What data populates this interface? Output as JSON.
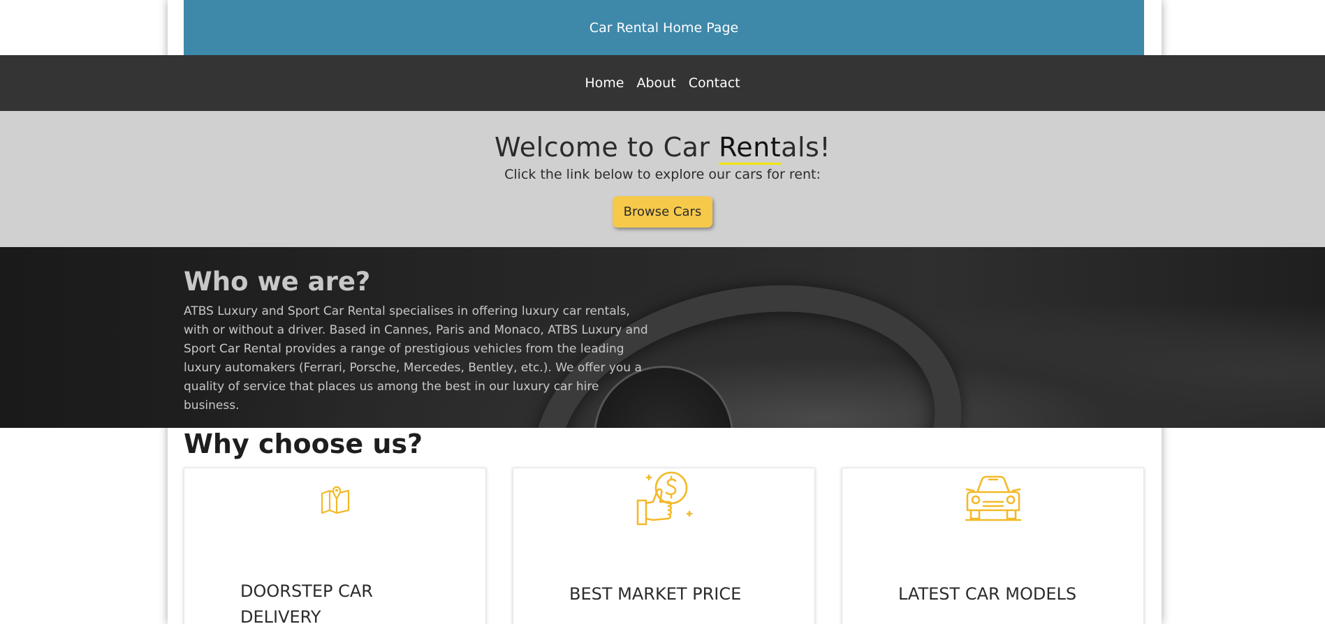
{
  "header": {
    "title": "Car Rental Home Page"
  },
  "nav": {
    "items": [
      {
        "label": "Home"
      },
      {
        "label": "About"
      },
      {
        "label": "Contact"
      }
    ]
  },
  "welcome": {
    "heading_pre": "Welcome to Car ",
    "heading_highlight": "Rent",
    "heading_post": "als!",
    "subtitle": "Click the link below to explore our cars for rent:",
    "button_label": "Browse Cars"
  },
  "about": {
    "heading": "Who we are?",
    "body": "ATBS Luxury and Sport Car Rental specialises in offering luxury car rentals, with or without a driver. Based in Cannes, Paris and Monaco, ATBS Luxury and Sport Car Rental provides a range of prestigious vehicles from the leading luxury automakers (Ferrari, Porsche, Mercedes, Bentley, etc.). We offer you a quality of service that places us among the best in our luxury car hire business."
  },
  "why": {
    "heading": "Why choose us?",
    "cards": [
      {
        "title_line1": "DOORSTEP CAR",
        "title_line2": "DELIVERY",
        "icon": "map-pin-icon"
      },
      {
        "title": "BEST MARKET PRICE",
        "icon": "thumbs-up-dollar-icon"
      },
      {
        "title": "LATEST CAR MODELS",
        "icon": "car-front-icon"
      }
    ]
  },
  "colors": {
    "title_bar": "#3e88aa",
    "nav_bar": "#343434",
    "welcome_bg": "#d0d0d0",
    "accent_yellow": "#f6c94a",
    "icon_yellow": "#f3b928"
  }
}
